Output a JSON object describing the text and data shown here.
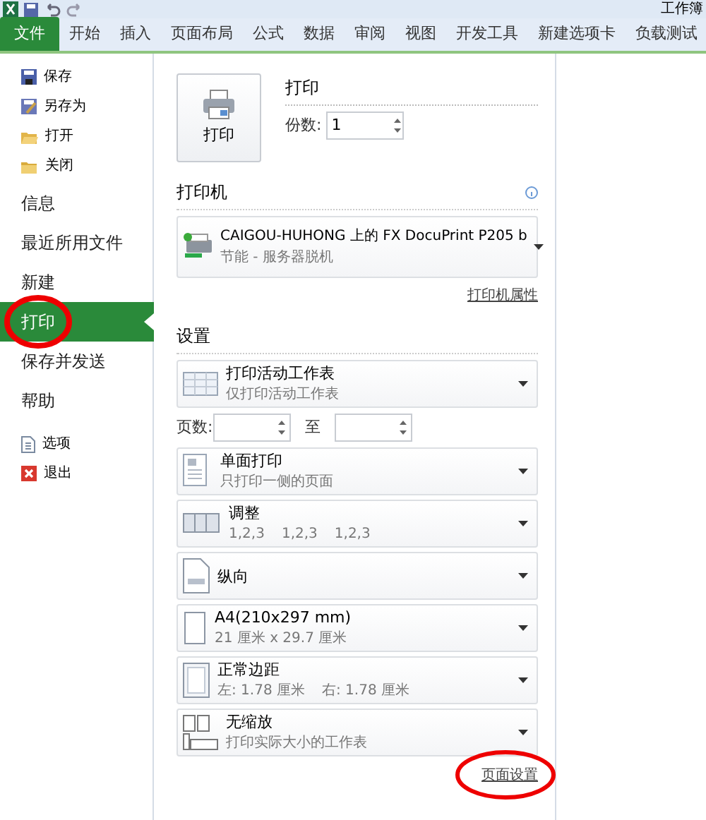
{
  "window": {
    "title": "工作簿"
  },
  "ribbon_tabs": [
    {
      "label": "文件",
      "selected": true
    },
    {
      "label": "开始",
      "selected": false
    },
    {
      "label": "插入",
      "selected": false
    },
    {
      "label": "页面布局",
      "selected": false
    },
    {
      "label": "公式",
      "selected": false
    },
    {
      "label": "数据",
      "selected": false
    },
    {
      "label": "审阅",
      "selected": false
    },
    {
      "label": "视图",
      "selected": false
    },
    {
      "label": "开发工具",
      "selected": false
    },
    {
      "label": "新建选项卡",
      "selected": false
    },
    {
      "label": "负载测试",
      "selected": false
    }
  ],
  "sidebar": {
    "items": [
      {
        "kind": "command",
        "label": "保存",
        "selected": false
      },
      {
        "kind": "command",
        "label": "另存为",
        "selected": false
      },
      {
        "kind": "command",
        "label": "打开",
        "selected": false
      },
      {
        "kind": "command",
        "label": "关闭",
        "selected": false
      },
      {
        "kind": "section",
        "label": "信息",
        "selected": false
      },
      {
        "kind": "section",
        "label": "最近所用文件",
        "selected": false
      },
      {
        "kind": "section",
        "label": "新建",
        "selected": false
      },
      {
        "kind": "section",
        "label": "打印",
        "selected": true
      },
      {
        "kind": "section",
        "label": "保存并发送",
        "selected": false
      },
      {
        "kind": "section",
        "label": "帮助",
        "selected": false
      },
      {
        "kind": "command",
        "label": "选项",
        "selected": false
      },
      {
        "kind": "command",
        "label": "退出",
        "selected": false
      }
    ]
  },
  "print": {
    "button": "打印",
    "heading": "打印",
    "copies_label": "份数:",
    "copies": "1"
  },
  "printer": {
    "heading": "打印机",
    "name": "CAIGOU-HUHONG 上的 FX DocuPrint P205 b",
    "status": "节能 - 服务器脱机",
    "properties_link": "打印机属性"
  },
  "settings": {
    "heading": "设置",
    "items": [
      {
        "kind": "dropdown",
        "title": "打印活动工作表",
        "subtitles": [
          "仅打印活动工作表"
        ]
      },
      {
        "kind": "pages",
        "label": "页数:",
        "separator": "至"
      },
      {
        "kind": "dropdown",
        "title": "单面打印",
        "subtitles": [
          "只打印一侧的页面"
        ]
      },
      {
        "kind": "dropdown",
        "title": "调整",
        "subtitles": [
          "1,2,3",
          "1,2,3",
          "1,2,3"
        ]
      },
      {
        "kind": "dropdown",
        "title": "纵向"
      },
      {
        "kind": "dropdown",
        "title": "A4(210x297 mm)",
        "subtitles": [
          "21 厘米 x 29.7 厘米"
        ]
      },
      {
        "kind": "dropdown",
        "title": "正常边距",
        "subtitles": [
          "左: 1.78 厘米",
          "右: 1.78 厘米"
        ]
      },
      {
        "kind": "dropdown",
        "title": "无缩放",
        "subtitles": [
          "打印实际大小的工作表"
        ]
      }
    ],
    "page_setup_link": "页面设置"
  }
}
